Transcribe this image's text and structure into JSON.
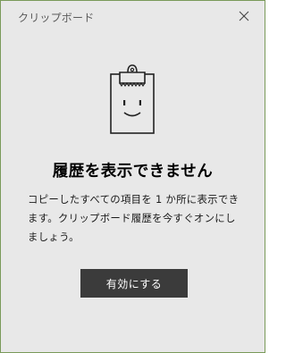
{
  "window": {
    "title": "クリップボード"
  },
  "icons": {
    "close": "close-icon",
    "illustration": "clipboard-smiley-icon"
  },
  "main": {
    "heading": "履歴を表示できません",
    "description": "コピーしたすべての項目を 1 か所に表示できます。クリップボード履歴を今すぐオンにしましょう。",
    "enable_button_label": "有効にする"
  },
  "colors": {
    "background": "#e8e8e8",
    "button": "#3b3b3b",
    "border": "#7a9a5a"
  }
}
